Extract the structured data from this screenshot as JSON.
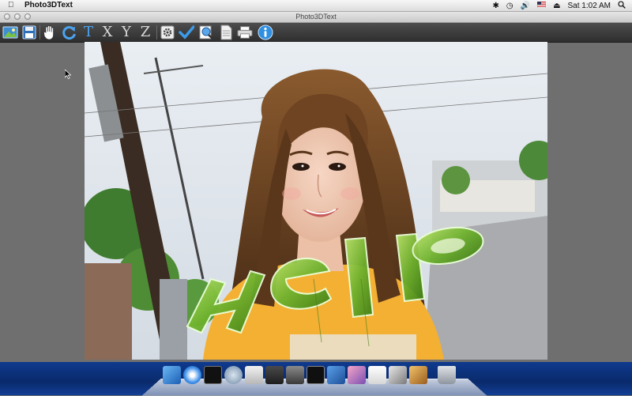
{
  "menubar": {
    "app_name": "Photo3DText",
    "clock": "Sat 1:02 AM",
    "status_icons": [
      "bluetooth-icon",
      "time-machine-icon",
      "volume-icon",
      "flag-icon",
      "eject-icon",
      "spotlight-icon"
    ]
  },
  "window": {
    "title": "Photo3DText"
  },
  "toolbar": {
    "items": [
      {
        "name": "open-image-button",
        "icon": "picture-icon"
      },
      {
        "name": "save-button",
        "icon": "floppy-disk-icon"
      },
      {
        "name": "pan-button",
        "icon": "hand-icon"
      },
      {
        "name": "rotate-button",
        "icon": "rotate-arrow-icon"
      },
      {
        "name": "text-tool-button",
        "label": "T"
      },
      {
        "name": "rotate-x-button",
        "label": "X"
      },
      {
        "name": "rotate-y-button",
        "label": "Y"
      },
      {
        "name": "rotate-z-button",
        "label": "Z"
      },
      {
        "name": "settings-button",
        "icon": "gear-icon"
      },
      {
        "name": "apply-button",
        "icon": "checkmark-icon"
      },
      {
        "name": "preview-button",
        "icon": "magnifier-icon"
      },
      {
        "name": "export-button",
        "icon": "document-icon"
      },
      {
        "name": "print-button",
        "icon": "printer-icon"
      },
      {
        "name": "info-button",
        "icon": "info-icon"
      }
    ]
  },
  "canvas": {
    "overlay_text": "Hello",
    "text_color": "#8cc63f"
  },
  "dock": {
    "apps": [
      "finder-icon",
      "safari-icon",
      "activity-monitor-icon",
      "network-utility-icon",
      "preview-icon",
      "dashboard-icon",
      "dvd-player-icon",
      "terminal-icon",
      "xcode-icon",
      "photo-booth-icon",
      "textedit-icon",
      "iphoto-icon",
      "iterm-icon",
      "trash-icon"
    ]
  },
  "colors": {
    "toolbar_bg": "#3c3c3c",
    "workspace_bg": "#6f6f6f",
    "dock_bg": "#0f3a8e",
    "accent_blue": "#1d7fd6"
  }
}
